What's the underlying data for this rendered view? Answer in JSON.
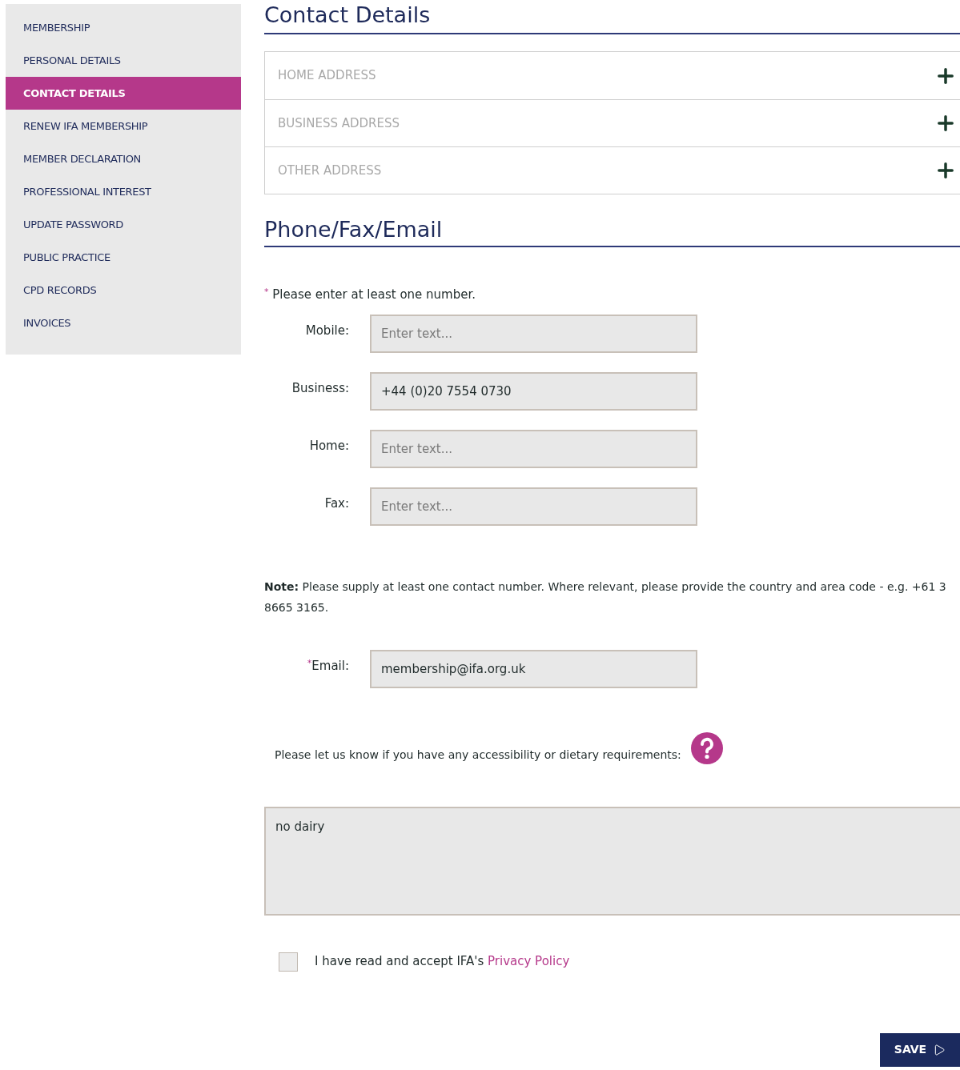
{
  "sidebar": {
    "items": [
      {
        "label": "MEMBERSHIP",
        "selected": false
      },
      {
        "label": "PERSONAL DETAILS",
        "selected": false
      },
      {
        "label": "CONTACT DETAILS",
        "selected": true
      },
      {
        "label": "RENEW IFA MEMBERSHIP",
        "selected": false
      },
      {
        "label": "MEMBER DECLARATION",
        "selected": false
      },
      {
        "label": "PROFESSIONAL INTEREST",
        "selected": false
      },
      {
        "label": "UPDATE PASSWORD",
        "selected": false
      },
      {
        "label": "PUBLIC PRACTICE",
        "selected": false
      },
      {
        "label": "CPD RECORDS",
        "selected": false
      },
      {
        "label": "INVOICES",
        "selected": false
      }
    ]
  },
  "contact_heading": "Contact Details",
  "addresses": [
    {
      "label": "HOME ADDRESS",
      "expanded": false
    },
    {
      "label": "BUSINESS ADDRESS",
      "expanded": false
    },
    {
      "label": "OTHER ADDRESS",
      "expanded": false
    }
  ],
  "phone_heading": "Phone/Fax/Email",
  "phone_note": {
    "mark": "*",
    "text": "Please enter at least one number."
  },
  "phone_fields": [
    {
      "label": "Mobile:",
      "placeholder": "Enter text..."
    },
    {
      "label": "Business:",
      "value": "+44 (0)20 7554 0730"
    },
    {
      "label": "Home:",
      "placeholder": "Enter text..."
    },
    {
      "label": "Fax:",
      "placeholder": "Enter text..."
    }
  ],
  "note": "**Note:** Please supply at least one contact number.  Where relevant, please provide the country and area code - e.g. +61 3 8665 3165.",
  "email": {
    "mark": "*",
    "label": "Email:",
    "value": "membership@ifa.org.uk"
  },
  "requirements": {
    "question": "Please let us know if you have any accessibility or dietary requirements:",
    "value": "no dairy"
  },
  "privacy": {
    "checked": false,
    "text": "I have read and accept IFA's",
    "link": "Privacy Policy"
  },
  "save_button": "SAVE"
}
